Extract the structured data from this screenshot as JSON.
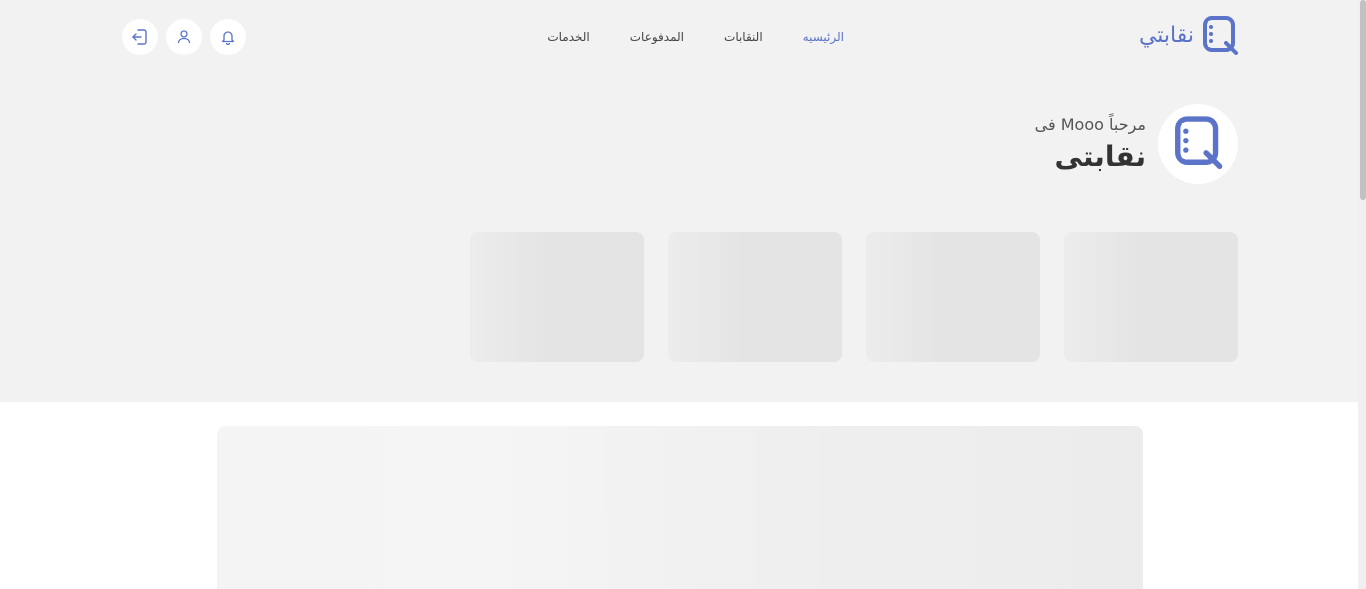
{
  "brand": {
    "name": "نقابتي",
    "logo_icon": "q-logo-icon",
    "accent_color": "#5b73c8"
  },
  "nav": {
    "items": [
      {
        "label": "الرئيسيه",
        "active": true
      },
      {
        "label": "النقابات",
        "active": false
      },
      {
        "label": "المدفوعات",
        "active": false
      },
      {
        "label": "الخدمات",
        "active": false
      }
    ]
  },
  "header_actions": {
    "icons": [
      "notification-bell-icon",
      "user-icon",
      "logout-icon"
    ]
  },
  "welcome": {
    "greeting": "مرحباً Mooo فى",
    "title": "نقابتى"
  },
  "colors": {
    "background_top": "#f2f2f2",
    "skeleton": "#e4e4e4",
    "page_background": "#ffffff"
  }
}
